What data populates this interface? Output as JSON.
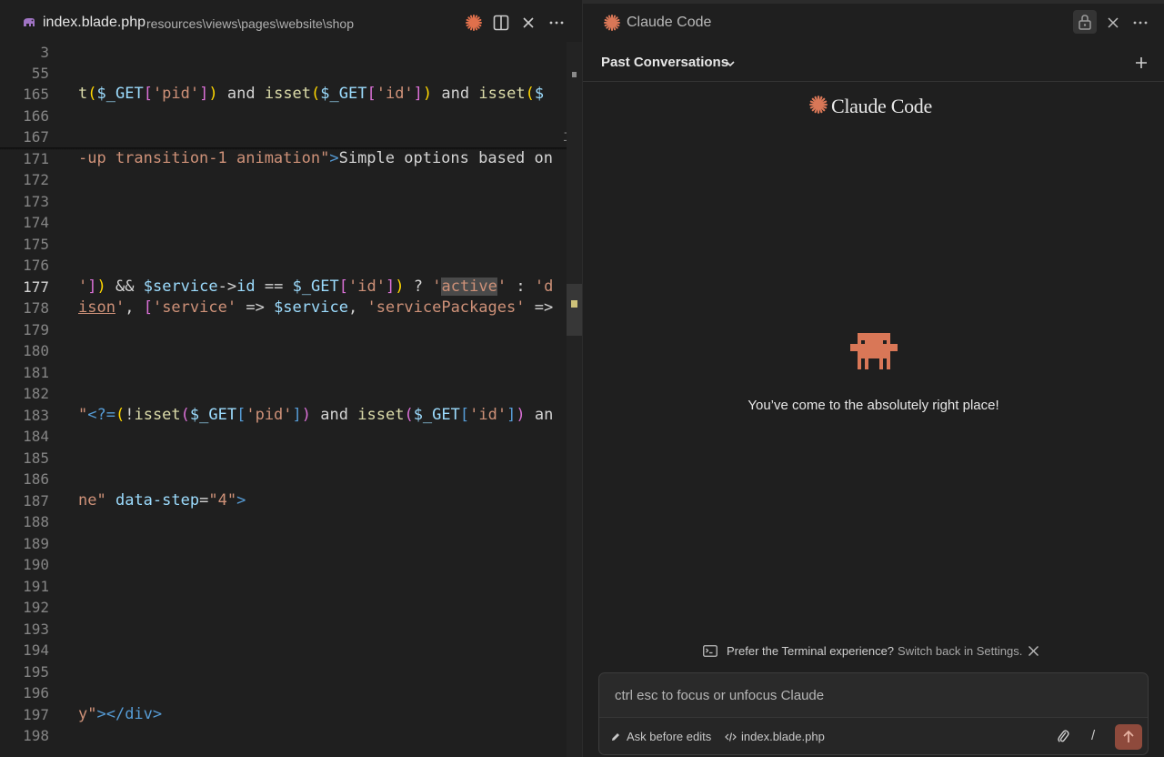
{
  "editor": {
    "tab": {
      "filename": "index.blade.php",
      "path": "resources\\views\\pages\\website\\shop"
    },
    "sticky_line_numbers": [
      "3",
      "55",
      "165",
      "166",
      "167"
    ],
    "line_numbers": [
      "171",
      "172",
      "173",
      "174",
      "175",
      "176",
      "177",
      "178",
      "179",
      "180",
      "181",
      "182",
      "183",
      "184",
      "185",
      "186",
      "187",
      "188",
      "189",
      "190",
      "191",
      "192",
      "193",
      "194",
      "195",
      "196",
      "197",
      "198"
    ],
    "active_line": "177"
  },
  "panel": {
    "title": "Claude Code",
    "conversations_label": "Past Conversations",
    "brand": "Claude Code",
    "welcome": "You’ve come to the absolutely right place!",
    "notice_text": "Prefer the Terminal experience?",
    "notice_link": "Switch back in Settings.",
    "input_placeholder": "ctrl esc to focus or unfocus Claude",
    "mode_label": "Ask before edits",
    "context_file": "index.blade.php",
    "slash": "/"
  },
  "colors": {
    "accent": "#d97757",
    "send_button": "#8e4a3c",
    "background": "#1f1f1f"
  }
}
